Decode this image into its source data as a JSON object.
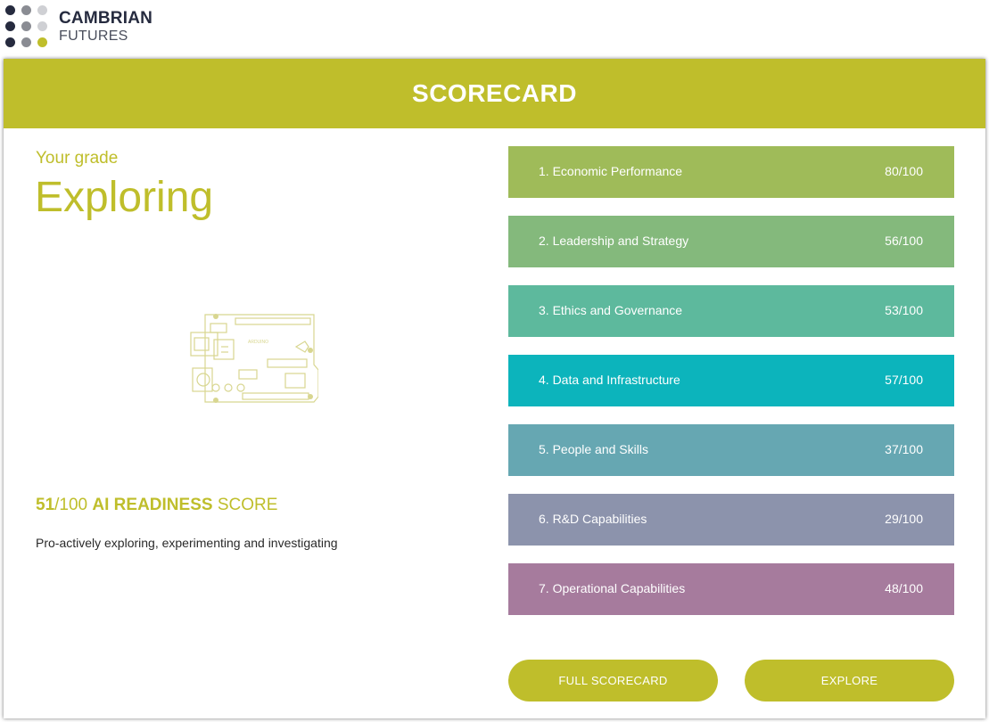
{
  "colors": {
    "accent": "#bfbe2b",
    "logo_dark": "#262b3f",
    "logo_grey": "#8a8c93",
    "logo_light": "#cfd0d4"
  },
  "logo": {
    "line1": "CAMBRIAN",
    "line2": "FUTURES"
  },
  "header": {
    "title": "SCORECARD"
  },
  "grade": {
    "label": "Your grade",
    "value": "Exploring"
  },
  "illustration": {
    "icon": "arduino-board-icon",
    "board_text": "ARDUINO"
  },
  "readiness": {
    "score": "51",
    "out_of": "/100",
    "label_bold": "AI READINESS",
    "label_suffix": "SCORE",
    "description": "Pro-actively exploring, experimenting and investigating"
  },
  "categories": [
    {
      "label": "1. Economic Performance",
      "score": "80/100",
      "color": "#9fbb59"
    },
    {
      "label": "2. Leadership and Strategy",
      "score": "56/100",
      "color": "#84b97c"
    },
    {
      "label": "3. Ethics and Governance",
      "score": "53/100",
      "color": "#5db99d"
    },
    {
      "label": "4. Data and Infrastructure",
      "score": "57/100",
      "color": "#0cb4bc"
    },
    {
      "label": "5. People and Skills",
      "score": "37/100",
      "color": "#66a7b2"
    },
    {
      "label": "6. R&D Capabilities",
      "score": "29/100",
      "color": "#8c93ac"
    },
    {
      "label": "7. Operational Capabilities",
      "score": "48/100",
      "color": "#a67b9d"
    }
  ],
  "buttons": {
    "full_scorecard": "FULL SCORECARD",
    "explore": "EXPLORE"
  }
}
